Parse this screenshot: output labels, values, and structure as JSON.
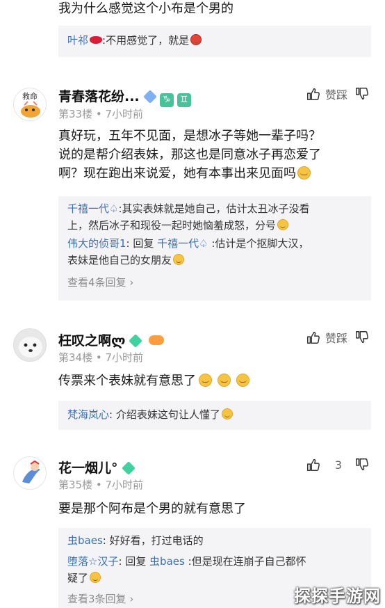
{
  "top": {
    "prev_comment_text": "我为什么感觉这个小布是个男的",
    "reply": {
      "user": "叶祁",
      "text": ":不用感觉了，就是"
    }
  },
  "comments": [
    {
      "name": "青春落花纷...",
      "floor": "第33楼 • 7小时前",
      "like_label": "赞踩",
      "text_lines": [
        "真好玩，五年不见面，是想冰子等她一辈子吗？",
        "说的是帮介绍表妹，那这也是同意冰子再恋爱了",
        "啊？现在跑出来说爱，她有本事出来见面吗"
      ],
      "replies": [
        {
          "user": "千禧一代♤",
          "text_lines": [
            ":其实表妹就是她自己，估计太丑冰子没看",
            "上，然后冰子和现役一起时她恼羞成怒，分号"
          ]
        },
        {
          "user": "伟大的侦哥1",
          "mid": ": 回复 ",
          "target": "千禧一代♤",
          "text_lines": [
            " :估计是个抠脚大汉，",
            "表妹是他自己的女朋友"
          ]
        }
      ],
      "more": "查看4条回复",
      "avatar_text": "救命"
    },
    {
      "name": "枉叹之啊ლ",
      "floor": "第34楼 • 7小时前",
      "like_label": "赞踩",
      "text": "传票来个表妹就有意思了",
      "replies": [
        {
          "user": "梵海岚心",
          "text": ": 介绍表妹这句让人懂了"
        }
      ]
    },
    {
      "name": "花一烟儿°",
      "floor": "第35楼 • 7小时前",
      "like_count": "3",
      "text": "要是那个阿布是个男的就有意思了",
      "replies": [
        {
          "user": "虫baes",
          "text": ": 好好看，打过电话的"
        },
        {
          "user": "堕落☆汉子",
          "mid": ": 回复 ",
          "target": "虫baes",
          "text_lines": [
            " :但是现在连崩子自己都怀",
            "疑了"
          ]
        }
      ],
      "more": "查看3条回复"
    }
  ],
  "watermark": "探探手游网",
  "colors": {
    "link": "#3a6fb6",
    "meta": "#9a9a9a",
    "reply_bg": "#f4f4f6"
  }
}
